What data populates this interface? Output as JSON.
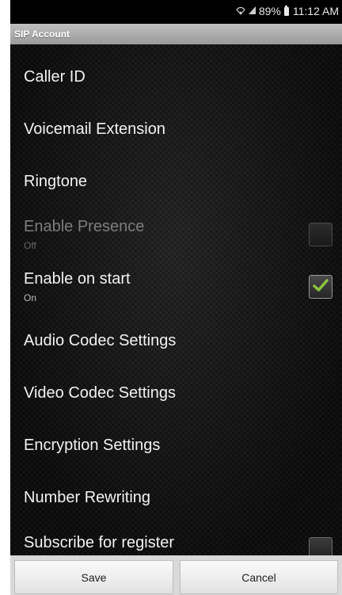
{
  "status_bar": {
    "signal_icon": "wifi-icon",
    "cell_icon": "cell-signal-icon",
    "battery_percent": "89%",
    "battery_icon": "battery-icon",
    "time": "11:12 AM"
  },
  "title_bar": {
    "title": "SIP Account"
  },
  "settings": [
    {
      "label": "Caller ID"
    },
    {
      "label": "Voicemail Extension"
    },
    {
      "label": "Ringtone"
    },
    {
      "label": "Enable Presence",
      "summary": "Off",
      "checked": false,
      "enabled": false
    },
    {
      "label": "Enable on start",
      "summary": "On",
      "checked": true,
      "enabled": true
    },
    {
      "label": "Audio Codec Settings"
    },
    {
      "label": "Video Codec Settings"
    },
    {
      "label": "Encryption Settings"
    },
    {
      "label": "Number Rewriting"
    },
    {
      "label": "Subscribe for register",
      "checked": false,
      "enabled": true
    }
  ],
  "buttons": {
    "save_label": "Save",
    "cancel_label": "Cancel"
  },
  "colors": {
    "check_mark": "#8bc53f",
    "background": "#161616",
    "title_bar": "#a8a8a8"
  }
}
